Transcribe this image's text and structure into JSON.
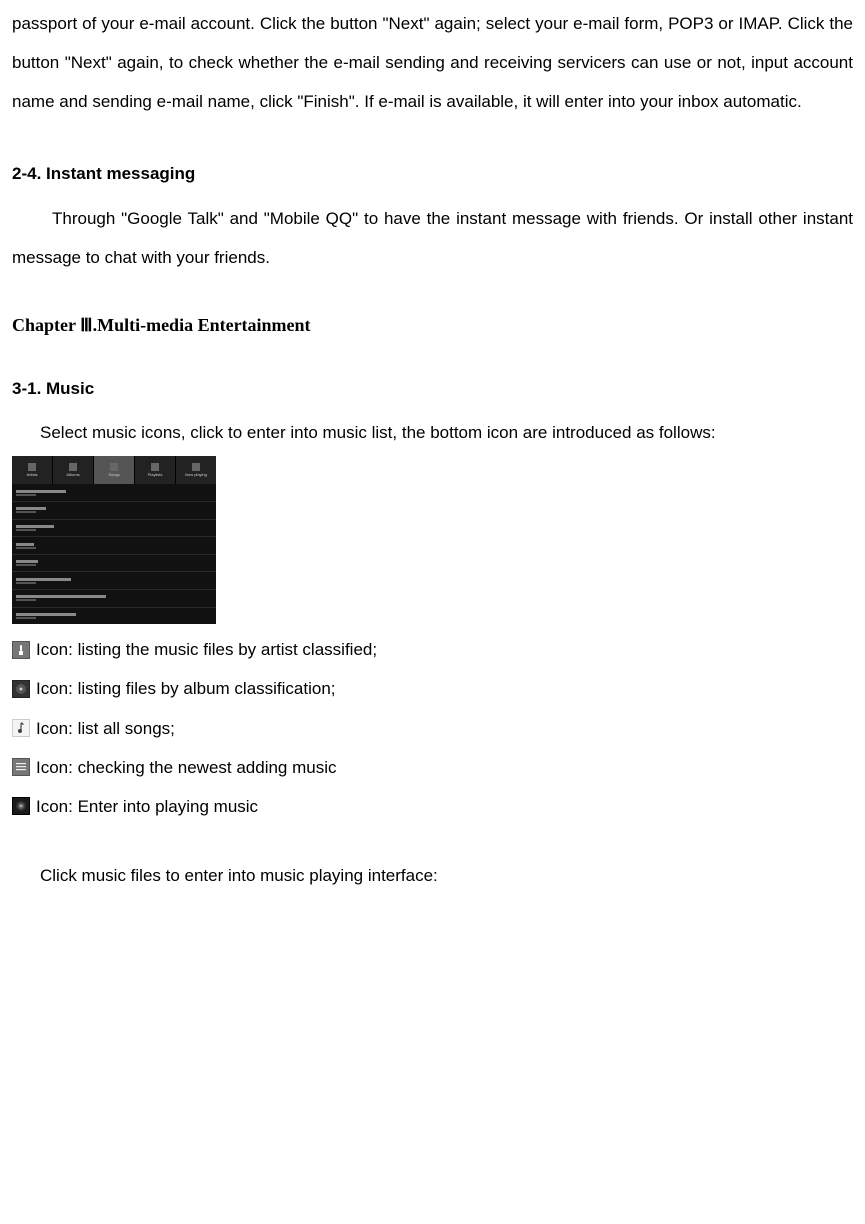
{
  "intro_para": "passport of your e-mail account. Click the button \"Next\" again; select your e-mail form, POP3 or IMAP. Click the button \"Next\" again, to check whether the e-mail sending and receiving servicers can use or not, input account name and sending e-mail name, click \"Finish\". If e-mail is available, it will enter into your inbox automatic.",
  "section_2_4": {
    "heading": "2-4. Instant messaging",
    "body": "Through \"Google Talk\" and \"Mobile QQ\" to have the instant message with friends. Or install other instant message to chat with your friends."
  },
  "chapter3": {
    "heading": "Chapter Ⅲ.Multi-media Entertainment"
  },
  "section_3_1": {
    "heading": "3-1. Music",
    "body": "Select music icons, click to enter into music list, the bottom icon are introduced as follows:",
    "tabs": [
      "Artists",
      "Albums",
      "Songs",
      "Playlists",
      "Now playing"
    ],
    "icon_descriptions": {
      "artist": " Icon: listing the music files by artist classified;",
      "album": " Icon: listing files by album classification;",
      "songs": " Icon: list all songs;",
      "newest": " Icon: checking the newest adding music",
      "playing": " Icon: Enter into playing music"
    },
    "closing": "Click music files to enter into music playing interface:"
  }
}
